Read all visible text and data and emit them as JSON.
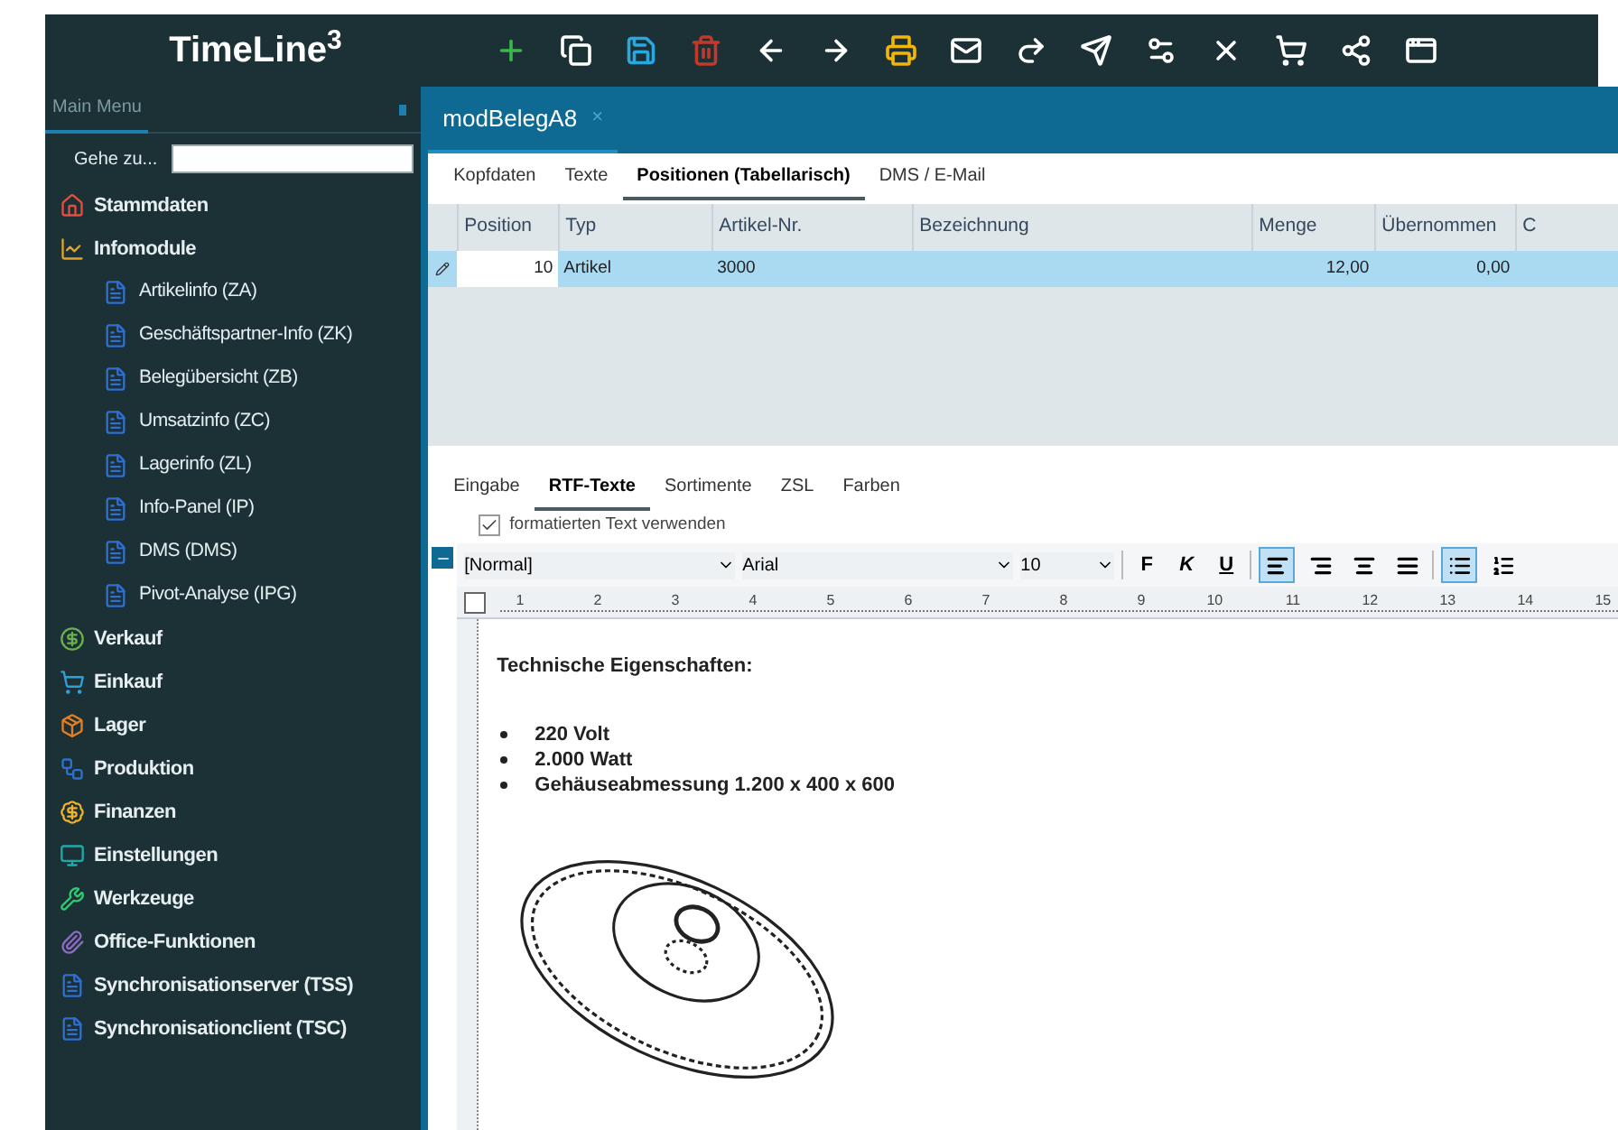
{
  "app": {
    "logo": "TimeLine$^{3}$"
  },
  "sidebar": {
    "tab": "Main Menu",
    "goto_label": "Gehe zu...",
    "items": [
      {
        "label": "Stammdaten"
      },
      {
        "label": "Infomodule",
        "children": [
          {
            "label": "Artikelinfo (ZA)"
          },
          {
            "label": "Geschäftspartner-Info (ZK)"
          },
          {
            "label": "Belegübersicht (ZB)"
          },
          {
            "label": "Umsatzinfo (ZC)"
          },
          {
            "label": "Lagerinfo (ZL)"
          },
          {
            "label": "Info-Panel (IP)"
          },
          {
            "label": "DMS (DMS)"
          },
          {
            "label": "Pivot-Analyse (IPG)"
          }
        ]
      },
      {
        "label": "Verkauf"
      },
      {
        "label": "Einkauf"
      },
      {
        "label": "Lager"
      },
      {
        "label": "Produktion"
      },
      {
        "label": "Finanzen"
      },
      {
        "label": "Einstellungen"
      },
      {
        "label": "Werkzeuge"
      },
      {
        "label": "Office-Funktionen"
      },
      {
        "label": "Synchronisationserver (TSS)"
      },
      {
        "label": "Synchronisationclient (TSC)"
      }
    ]
  },
  "document_tab": {
    "title": "modBelegA8",
    "close": "×"
  },
  "tabs": [
    {
      "label": "Kopfdaten",
      "selected": false
    },
    {
      "label": "Texte",
      "selected": false
    },
    {
      "label": "Positionen (Tabellarisch)",
      "selected": true
    },
    {
      "label": "DMS / E-Mail",
      "selected": false
    }
  ],
  "table": {
    "columns": [
      "Position",
      "Typ",
      "Artikel-Nr.",
      "Bezeichnung",
      "Menge",
      "Übernommen",
      "C"
    ],
    "rows": [
      {
        "selected": true,
        "cells": [
          "10",
          "Artikel",
          "3000",
          "",
          "12,00",
          "0,00",
          ""
        ]
      }
    ]
  },
  "sub_tabs": [
    {
      "label": "Eingabe",
      "selected": false
    },
    {
      "label": "RTF-Texte",
      "selected": true
    },
    {
      "label": "Sortimente",
      "selected": false
    },
    {
      "label": "ZSL",
      "selected": false
    },
    {
      "label": "Farben",
      "selected": false
    }
  ],
  "editor": {
    "use_formatted": {
      "label": "formatierten Text verwenden",
      "checked": true
    },
    "style": "[Normal]",
    "font": "Arial",
    "size": "10",
    "format_buttons": [
      {
        "label": "F",
        "kind": "bold"
      },
      {
        "label": "K",
        "kind": "italic"
      },
      {
        "label": "U",
        "kind": "underline"
      }
    ],
    "align_buttons": [
      {
        "selected": true
      },
      {
        "selected": false
      },
      {
        "selected": false
      },
      {
        "selected": false
      }
    ],
    "list_buttons": [
      {
        "selected": true
      },
      {
        "selected": false
      }
    ],
    "ruler": [
      "1",
      "2",
      "3",
      "4",
      "5",
      "6",
      "7",
      "8",
      "9",
      "10",
      "11",
      "12",
      "13",
      "14",
      "15"
    ],
    "heading": "Technische Eigenschaften:",
    "bullets": [
      "220 Volt",
      "2.000 Watt",
      "Gehäuseabmessung 1.200 x 400 x 600"
    ]
  }
}
